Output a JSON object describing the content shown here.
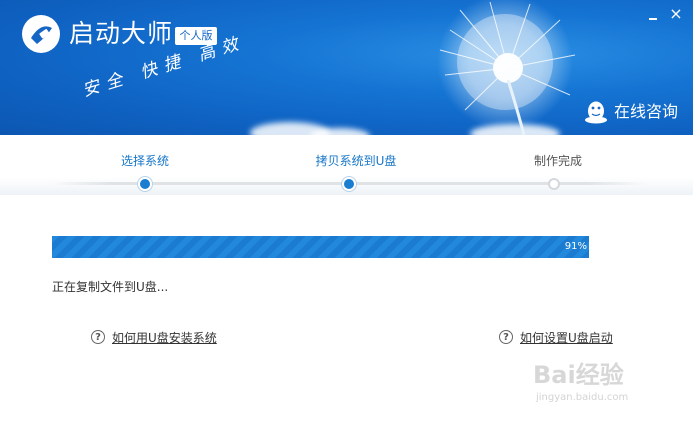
{
  "header": {
    "app_title": "启动大师",
    "edition_badge": "个人版",
    "slogan": "安全 快捷 高效",
    "support_label": "在线咨询",
    "close_glyph": "×"
  },
  "steps": [
    {
      "label": "选择系统",
      "state": "done"
    },
    {
      "label": "拷贝系统到U盘",
      "state": "current"
    },
    {
      "label": "制作完成",
      "state": "pending"
    }
  ],
  "progress": {
    "percent": 0.91,
    "label": "91%",
    "status_text": "正在复制文件到U盘..."
  },
  "help_links": {
    "install_guide": "如何用U盘安装系统",
    "boot_setup": "如何设置U盘启动",
    "icon_glyph": "?"
  },
  "watermark": {
    "brand": "Bai经验",
    "site": "jingyan.baidu.com"
  },
  "colors": {
    "accent": "#1a7bd0",
    "header_bg": "#1268c9",
    "step_active": "#1676c8",
    "step_pending": "#555555"
  }
}
